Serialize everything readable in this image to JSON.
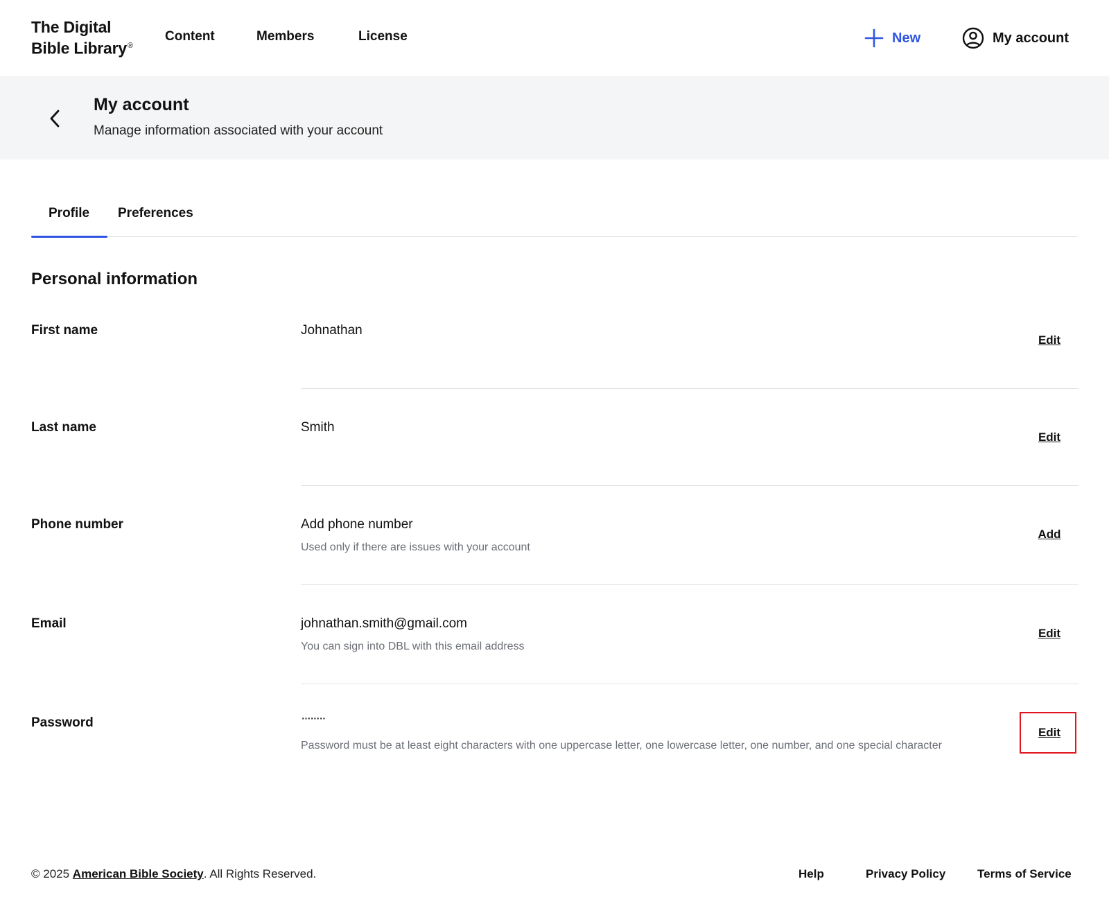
{
  "header": {
    "logo_line1": "The Digital",
    "logo_line2": "Bible Library",
    "logo_reg": "®",
    "nav": [
      "Content",
      "Members",
      "License"
    ],
    "new_label": "New",
    "account_label": "My account",
    "accent_color": "#2f55e0"
  },
  "page": {
    "title": "My account",
    "subtitle": "Manage information associated with your account"
  },
  "tabs": [
    {
      "label": "Profile",
      "active": true
    },
    {
      "label": "Preferences",
      "active": false
    }
  ],
  "section": {
    "title": "Personal information",
    "rows": [
      {
        "label": "First name",
        "value": "Johnathan",
        "help": "",
        "action": "Edit"
      },
      {
        "label": "Last name",
        "value": "Smith",
        "help": "",
        "action": "Edit"
      },
      {
        "label": "Phone number",
        "value": "Add phone number",
        "help": "Used only if there are issues with your account",
        "action": "Add"
      },
      {
        "label": "Email",
        "value": "johnathan.smith@gmail.com",
        "help": "You can sign into DBL with this email address",
        "action": "Edit"
      },
      {
        "label": "Password",
        "value": "········",
        "help": "Password must be at least eight characters with one uppercase letter, one lowercase letter, one number, and one special character",
        "action": "Edit"
      }
    ]
  },
  "footer": {
    "copyright_prefix": "© 2025 ",
    "org": "American Bible Society",
    "copyright_suffix": ". All Rights Reserved.",
    "links": [
      "Help",
      "Privacy Policy",
      "Terms of Service"
    ]
  }
}
